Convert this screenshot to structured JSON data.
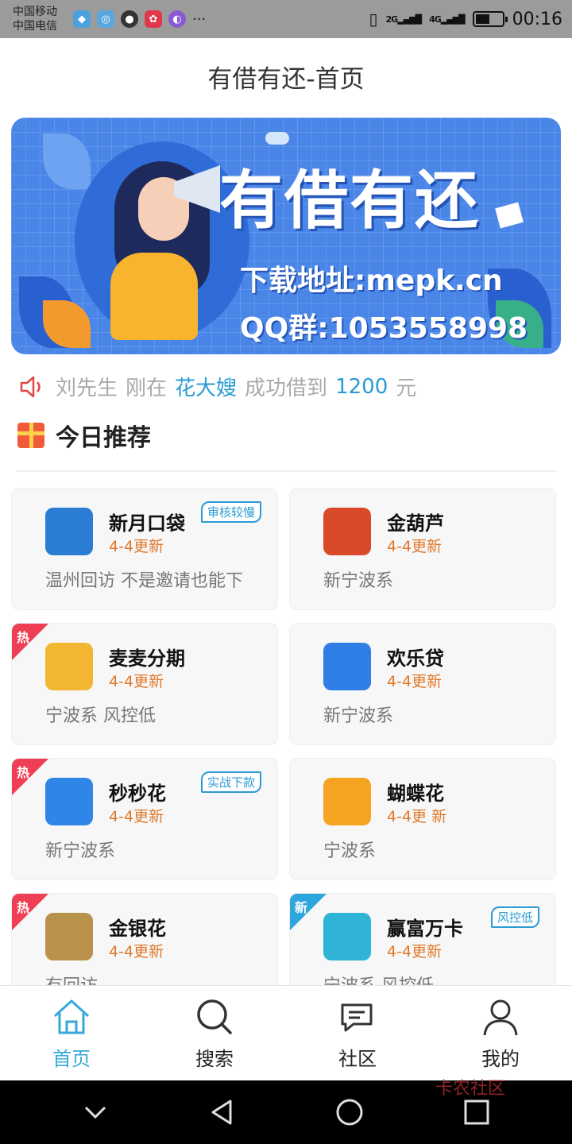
{
  "status_bar": {
    "carrier1": "中国移动",
    "carrier2": "中国电信",
    "network1": "2G",
    "network2": "4G",
    "more": "···",
    "time": "00:16",
    "battery_level": 0.55
  },
  "header": {
    "title": "有借有还-首页"
  },
  "banner": {
    "title": "有借有还",
    "line1": "下载地址:mepk.cn",
    "line2": "QQ群:1053558998"
  },
  "ticker": {
    "name": "刘先生",
    "action": "刚在",
    "product": "花大嫂",
    "result": "成功借到",
    "amount": "1200",
    "unit": "元"
  },
  "section": {
    "title": "今日推荐"
  },
  "cards": [
    {
      "name": "新月口袋",
      "update": "4-4更新",
      "desc": "温州回访 不是邀请也能下",
      "tag": "审核较慢",
      "corner": "",
      "logo_color": "#2b7cd3"
    },
    {
      "name": "金葫芦",
      "update": "4-4更新",
      "desc": "新宁波系",
      "tag": "",
      "corner": "",
      "logo_color": "#d84a2a"
    },
    {
      "name": "麦麦分期",
      "update": "4-4更新",
      "desc": "宁波系 风控低",
      "tag": "",
      "corner": "热",
      "logo_color": "#f2b632"
    },
    {
      "name": "欢乐贷",
      "update": "4-4更新",
      "desc": "新宁波系",
      "tag": "",
      "corner": "",
      "logo_color": "#2f7ee6"
    },
    {
      "name": "秒秒花",
      "update": "4-4更新",
      "desc": "新宁波系",
      "tag": "实战下款",
      "corner": "热",
      "logo_color": "#2f86e8"
    },
    {
      "name": "蝴蝶花",
      "update": "4-4更 新",
      "desc": "宁波系",
      "tag": "",
      "corner": "",
      "logo_color": "#f6a321"
    },
    {
      "name": "金银花",
      "update": "4-4更新",
      "desc": "有回访",
      "tag": "",
      "corner": "热",
      "logo_color": "#b8924a"
    },
    {
      "name": "赢富万卡",
      "update": "4-4更新",
      "desc": "宁波系 风控低",
      "tag": "风控低",
      "corner": "新",
      "logo_color": "#2fb3d6"
    }
  ],
  "nav": {
    "home": "首页",
    "search": "搜索",
    "community": "社区",
    "mine": "我的"
  },
  "colors": {
    "accent": "#36a9d9",
    "update_orange": "#e0782a",
    "hot_red": "#ef3f55",
    "new_blue": "#2ea6dd",
    "banner_blue": "#4a86e8"
  },
  "watermark": "卡农社区"
}
